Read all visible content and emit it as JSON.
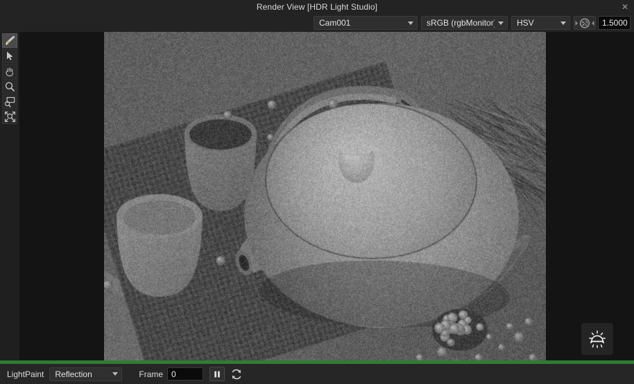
{
  "window": {
    "title": "Render View [HDR Light Studio]",
    "close_label": "✕"
  },
  "topbar": {
    "camera": {
      "value": "Cam001",
      "icon": "chevron-down-icon"
    },
    "colorspace": {
      "value": "sRGB (rgbMonitor)",
      "icon": "chevron-down-icon"
    },
    "channel": {
      "value": "HSV",
      "icon": "chevron-down-icon"
    },
    "aperture_icon": "aperture-icon",
    "exposure": {
      "value": "1.5000"
    }
  },
  "tools": [
    {
      "name": "paint-brush-tool",
      "icon": "paint-brush-icon",
      "selected": true
    },
    {
      "name": "select-arrow-tool",
      "icon": "cursor-arrow-icon",
      "selected": false
    },
    {
      "name": "pan-tool",
      "icon": "hand-icon",
      "selected": false
    },
    {
      "name": "zoom-tool",
      "icon": "magnifier-icon",
      "selected": false
    },
    {
      "name": "zoom-region-tool",
      "icon": "magnifier-region-icon",
      "selected": false
    },
    {
      "name": "zoom-fit-tool",
      "icon": "magnifier-fit-icon",
      "selected": false
    }
  ],
  "viewport": {
    "render_description": "Grayscale noisy ray-traced render of a ceramic teapot with lid and two cups on a woven bamboo mat, with a wooden spoon, scattered berries and dried wheat on a tabletop",
    "light_badge_icon": "sun-light-icon"
  },
  "progress": {
    "percent": 100,
    "color": "#2f7d32"
  },
  "statusbar": {
    "lightpaint_label": "LightPaint",
    "lightpaint_mode": {
      "value": "Reflection",
      "icon": "chevron-down-icon"
    },
    "frame_label": "Frame",
    "frame_value": "0",
    "pause_button": {
      "name": "pause-button",
      "icon": "pause-icon"
    },
    "refresh_button": {
      "name": "refresh-button",
      "icon": "refresh-icon"
    }
  },
  "colors": {
    "window_bg": "#1e1e1e",
    "panel_bg": "#232323",
    "viewport_bg": "#141414",
    "statusbar_bg": "#262626",
    "accent_green": "#2f7d32",
    "text": "#d6d6d6"
  }
}
